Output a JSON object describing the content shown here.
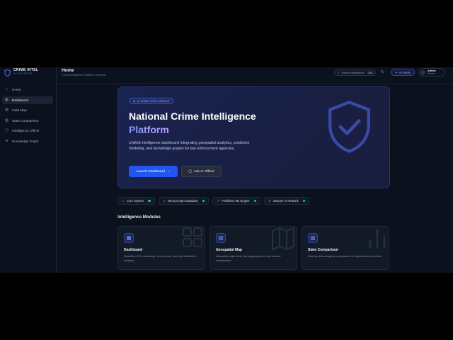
{
  "brand": {
    "title": "CRIME INTEL",
    "subtitle": "AI PLATFORM",
    "accent": "#2157f0"
  },
  "sidebar": {
    "items": [
      {
        "label": "Home",
        "icon": "home-icon",
        "active": false
      },
      {
        "label": "Dashboard",
        "icon": "dashboard-icon",
        "active": true
      },
      {
        "label": "India Map",
        "icon": "map-icon",
        "active": false
      },
      {
        "label": "State Comparison",
        "icon": "bar-chart-icon",
        "active": false
      },
      {
        "label": "Intelligence Officer",
        "icon": "chat-icon",
        "active": false
      },
      {
        "label": "Knowledge Graph",
        "icon": "graph-icon",
        "active": false
      }
    ]
  },
  "header": {
    "title": "Home",
    "subtitle": "Crime Intelligence Platform Overview",
    "search_placeholder": "Search databases",
    "search_shortcut": "⌘K",
    "ai_assist_label": "AI Assist",
    "user_name": "Admin",
    "user_role": "Director"
  },
  "hero": {
    "badge": "AI CRIME INTELLIGENCE",
    "title_line1": "National Crime Intelligence",
    "title_line2": "Platform",
    "description": "Unified intelligence dashboard integrating geospatial analytics, predictive modeling, and knowledge graphs for law enforcement agencies.",
    "primary_button": "Launch Dashboard",
    "secondary_button": "Ask AI Officer"
  },
  "status_chips": [
    {
      "label": "Core System",
      "icon": "pulse-icon",
      "status_color": "#19c39a"
    },
    {
      "label": "Neo4j Graph Database",
      "icon": "database-icon",
      "status_color": "#19c39a"
    },
    {
      "label": "Predictive ML Engine",
      "icon": "trend-icon",
      "status_color": "#19c39a"
    },
    {
      "label": "Sarvam AI Network",
      "icon": "network-icon",
      "status_color": "#19c39a"
    }
  ],
  "modules": {
    "title": "Intelligence Modules",
    "cards": [
      {
        "title": "Dashboard",
        "description": "Real-time KPI monitoring, crime trends, and risk distribution analysis.",
        "icon": "dashboard-icon"
      },
      {
        "title": "Geospatial Map",
        "description": "Interactive state-level risk mapping and crime volume visualization.",
        "icon": "map-icon"
      },
      {
        "title": "State Comparison",
        "description": "Side-by-side analytical comparison of regional crime metrics.",
        "icon": "bar-chart-icon"
      }
    ]
  }
}
